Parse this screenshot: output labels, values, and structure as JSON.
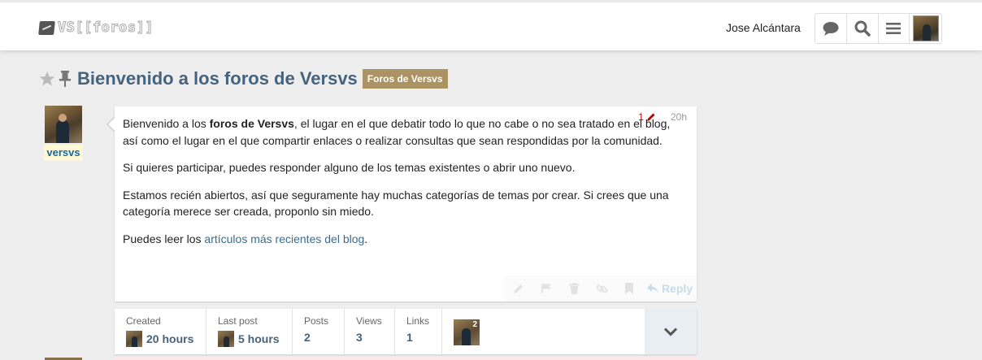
{
  "header": {
    "logo_text": "VS[[foros]]",
    "username": "Jose Alcántara",
    "icons": [
      "chat-bubble-icon",
      "search-icon",
      "hamburger-menu-icon",
      "user-avatar"
    ]
  },
  "topic": {
    "title": "Bienvenido a los foros de Versvs",
    "category": "Foros de Versvs",
    "category_color": "#ab9364"
  },
  "post": {
    "username": "versvs",
    "edit_count": "1",
    "age": "20h",
    "paragraphs": {
      "p1_a": "Bienvenido a los ",
      "p1_bold": "foros de Versvs",
      "p1_b": ", el lugar en el que debatir todo lo que no cabe o no sea tratado en el blog, así como el lugar en el que compartir enlaces o realizar consultas que sean respondidas por la comunidad.",
      "p2": "Si quieres participar, puedes responder alguno de los temas existentes o abrir uno nuevo.",
      "p3": "Estamos recién abiertos, así que seguramente hay muchas categorías de temas por crear. Si crees que una categoría merece ser creada, proponlo sin miedo.",
      "p4_a": "Puedes leer los ",
      "p4_link": "artículos más recientes del blog",
      "p4_b": "."
    },
    "reply_label": "Reply"
  },
  "topic_map": {
    "created_label": "Created",
    "created_value": "20 hours",
    "last_post_label": "Last post",
    "last_post_value": "5 hours",
    "posts_label": "Posts",
    "posts_value": "2",
    "views_label": "Views",
    "views_value": "3",
    "links_label": "Links",
    "links_value": "1",
    "poster_count": "2"
  }
}
